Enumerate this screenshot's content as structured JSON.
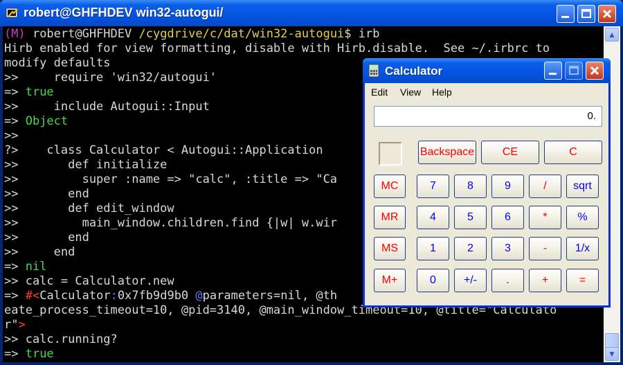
{
  "window": {
    "title": "robert@GHFHDEV  win32-autogui/"
  },
  "terminal": {
    "lines": [
      [
        {
          "t": "(M) ",
          "c": "p"
        },
        {
          "t": "robert@GHFHDEV ",
          "c": "w"
        },
        {
          "t": "/cygdrive/c/dat/win32-autogui",
          "c": "y"
        },
        {
          "t": "$ irb",
          "c": "w"
        }
      ],
      [
        {
          "t": "Hirb enabled for view formatting, disable with Hirb.disable.  See ~/.irbrc to",
          "c": "w"
        }
      ],
      [
        {
          "t": "modify defaults",
          "c": "w"
        }
      ],
      [
        {
          "t": ">>     require 'win32/autogui'",
          "c": "w"
        }
      ],
      [
        {
          "t": "=> ",
          "c": "w"
        },
        {
          "t": "true",
          "c": "g"
        }
      ],
      [
        {
          "t": ">>     include Autogui::Input",
          "c": "w"
        }
      ],
      [
        {
          "t": "=> ",
          "c": "w"
        },
        {
          "t": "Object",
          "c": "g"
        }
      ],
      [
        {
          "t": ">>",
          "c": "w"
        }
      ],
      [
        {
          "t": "?>    class Calculator < Autogui::Application",
          "c": "w"
        }
      ],
      [
        {
          "t": ">>       def initialize",
          "c": "w"
        }
      ],
      [
        {
          "t": ">>         super :name => \"calc\", :title => \"Ca",
          "c": "w"
        }
      ],
      [
        {
          "t": ">>       end",
          "c": "w"
        }
      ],
      [
        {
          "t": ">>       def edit_window",
          "c": "w"
        }
      ],
      [
        {
          "t": ">>         main_window.children.find {|w| w.wir",
          "c": "w"
        }
      ],
      [
        {
          "t": ">>       end",
          "c": "w"
        }
      ],
      [
        {
          "t": ">>     end",
          "c": "w"
        }
      ],
      [
        {
          "t": "=> ",
          "c": "w"
        },
        {
          "t": "nil",
          "c": "g"
        }
      ],
      [
        {
          "t": ">> calc = Calculator.new",
          "c": "w"
        }
      ],
      [
        {
          "t": "=> ",
          "c": "w"
        },
        {
          "t": "#<",
          "c": "r"
        },
        {
          "t": "Calculator",
          "c": "w"
        },
        {
          "t": ":",
          "c": "b"
        },
        {
          "t": "0x7fb9d9b0 ",
          "c": "w"
        },
        {
          "t": "@",
          "c": "b"
        },
        {
          "t": "parameters=nil, @th",
          "c": "w"
        }
      ],
      [
        {
          "t": "eate_process_timeout=10, @pid=3140, @main_window_timeout=10, @title=\"Calculato",
          "c": "w"
        }
      ],
      [
        {
          "t": "r\"",
          "c": "w"
        },
        {
          "t": ">",
          "c": "r"
        }
      ],
      [
        {
          "t": ">> calc.running?",
          "c": "w"
        }
      ],
      [
        {
          "t": "=> ",
          "c": "w"
        },
        {
          "t": "true",
          "c": "g"
        }
      ]
    ]
  },
  "calculator": {
    "title": "Calculator",
    "menu": [
      "Edit",
      "View",
      "Help"
    ],
    "display": "0.",
    "top_keys": [
      {
        "label": "Backspace",
        "color": "red"
      },
      {
        "label": "CE",
        "color": "red"
      },
      {
        "label": "C",
        "color": "red"
      }
    ],
    "rows": [
      [
        {
          "label": "MC",
          "color": "red"
        },
        {
          "label": "7",
          "color": "blue"
        },
        {
          "label": "8",
          "color": "blue"
        },
        {
          "label": "9",
          "color": "blue"
        },
        {
          "label": "/",
          "color": "red"
        },
        {
          "label": "sqrt",
          "color": "blue"
        }
      ],
      [
        {
          "label": "MR",
          "color": "red"
        },
        {
          "label": "4",
          "color": "blue"
        },
        {
          "label": "5",
          "color": "blue"
        },
        {
          "label": "6",
          "color": "blue"
        },
        {
          "label": "*",
          "color": "red"
        },
        {
          "label": "%",
          "color": "blue"
        }
      ],
      [
        {
          "label": "MS",
          "color": "red"
        },
        {
          "label": "1",
          "color": "blue"
        },
        {
          "label": "2",
          "color": "blue"
        },
        {
          "label": "3",
          "color": "blue"
        },
        {
          "label": "-",
          "color": "red"
        },
        {
          "label": "1/x",
          "color": "blue"
        }
      ],
      [
        {
          "label": "M+",
          "color": "red"
        },
        {
          "label": "0",
          "color": "blue"
        },
        {
          "label": "+/-",
          "color": "blue"
        },
        {
          "label": ".",
          "color": "blue"
        },
        {
          "label": "+",
          "color": "red"
        },
        {
          "label": "=",
          "color": "red"
        }
      ]
    ]
  },
  "colors": {
    "titlebar": "#0555e3",
    "terminal_bg": "#000000",
    "calc_bg": "#ece9d8"
  }
}
